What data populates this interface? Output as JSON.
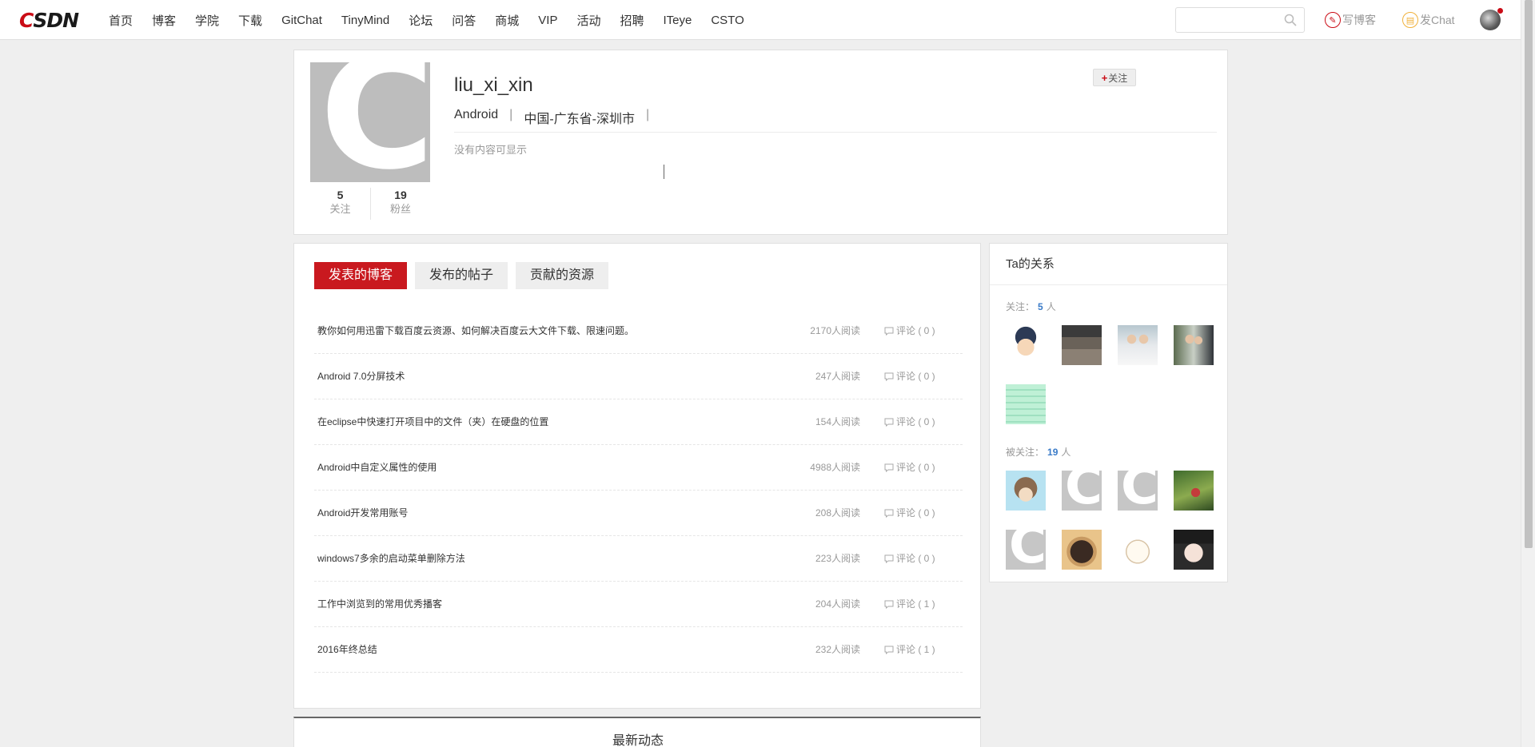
{
  "logo": "CSDN",
  "nav": [
    "首页",
    "博客",
    "学院",
    "下载",
    "GitChat",
    "TinyMind",
    "论坛",
    "问答",
    "商城",
    "VIP",
    "活动",
    "招聘",
    "ITeye",
    "CSTO"
  ],
  "search": {
    "placeholder": ""
  },
  "toolbar": {
    "write_label": "写博客",
    "chat_label": "发Chat"
  },
  "profile": {
    "avatar_letter": "C",
    "username": "liu_xi_xin",
    "field": "Android",
    "location": "中国-广东省-深圳市",
    "separator": "|",
    "no_content": "没有内容可显示",
    "follow_label": "关注",
    "following_count": "5",
    "following_label": "关注",
    "fans_count": "19",
    "fans_label": "粉丝"
  },
  "tabs": [
    {
      "label": "发表的博客",
      "active": true
    },
    {
      "label": "发布的帖子",
      "active": false
    },
    {
      "label": "贡献的资源",
      "active": false
    }
  ],
  "posts": [
    {
      "title": "教你如何用迅雷下载百度云资源、如何解决百度云大文件下载、限速问题。",
      "reads": "2170人阅读",
      "comments": "评论 ( 0 )"
    },
    {
      "title": "Android 7.0分屏技术",
      "reads": "247人阅读",
      "comments": "评论 ( 0 )"
    },
    {
      "title": "在eclipse中快速打开项目中的文件（夹）在硬盘的位置",
      "reads": "154人阅读",
      "comments": "评论 ( 0 )"
    },
    {
      "title": "Android中自定义属性的使用",
      "reads": "4988人阅读",
      "comments": "评论 ( 0 )"
    },
    {
      "title": "Android开发常用账号",
      "reads": "208人阅读",
      "comments": "评论 ( 0 )"
    },
    {
      "title": "windows7多余的启动菜单删除方法",
      "reads": "223人阅读",
      "comments": "评论 ( 0 )"
    },
    {
      "title": "工作中浏览到的常用优秀播客",
      "reads": "204人阅读",
      "comments": "评论 ( 1 )"
    },
    {
      "title": "2016年终总结",
      "reads": "232人阅读",
      "comments": "评论 ( 1 )"
    }
  ],
  "news": {
    "title": "最新动态"
  },
  "relations": {
    "title": "Ta的关系",
    "following_prefix": "关注：",
    "following_count": "5",
    "following_unit": "人",
    "fans_prefix": "被关注：",
    "fans_count": "19",
    "fans_unit": "人",
    "following_avatars": [
      "cartoon-boy",
      "room-photo",
      "couple-photo",
      "wedding-photo",
      "math-image"
    ],
    "fans_avatars": [
      "monkey",
      "default-c",
      "default-c",
      "outdoor-photo",
      "default-c",
      "bear",
      "cartoon-face",
      "girl-glasses"
    ]
  }
}
